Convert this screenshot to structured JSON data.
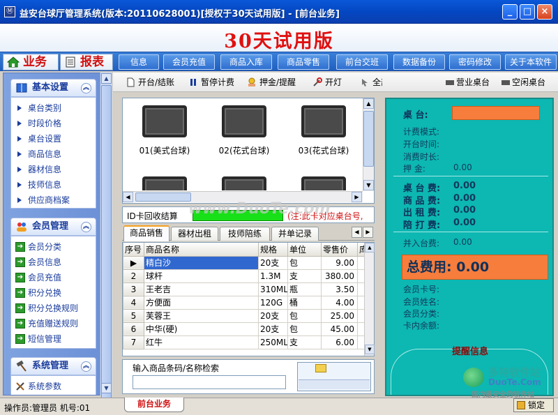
{
  "window": {
    "title": "益安台球厅管理系统(版本:20110628001)[授权于30天试用版] - [前台业务]",
    "min_symbol": "_",
    "max_symbol": "□",
    "close_symbol": "×"
  },
  "banner": {
    "trial_text": "30天试用版"
  },
  "nav": {
    "tab_business": "业务",
    "tab_report": "报表",
    "buttons": [
      "信息",
      "会员充值",
      "商品入库",
      "商品零售",
      "前台交班",
      "数据备份",
      "密码修改",
      "关于本软件"
    ]
  },
  "left": {
    "groups": [
      {
        "title": "基本设置",
        "items": [
          "桌台类别",
          "时段价格",
          "桌台设置",
          "商品信息",
          "器材信息",
          "技师信息",
          "供应商档案"
        ]
      },
      {
        "title": "会员管理",
        "items": [
          "会员分类",
          "会员信息",
          "会员充值",
          "积分兑换",
          "积分兑换规则",
          "充值赠送规则",
          "短信管理"
        ]
      },
      {
        "title": "系统管理",
        "items": [
          "系统参数"
        ]
      }
    ]
  },
  "toolbar": {
    "buttons": [
      "开台/结账",
      "暂停计费",
      "押金/提醒",
      "开灯"
    ],
    "right_fragments": [
      "全部显示",
      "营业桌台",
      "空闲桌台"
    ]
  },
  "tables": [
    {
      "label": "01(美式台球)"
    },
    {
      "label": "02(花式台球)"
    },
    {
      "label": "03(花式台球)"
    }
  ],
  "idcard": {
    "label": "ID卡回收结算",
    "note": "(注:此卡对应桌台号,"
  },
  "watermark_center": "www.DuoTe.com",
  "product_tabs": [
    "商品销售",
    "器材出租",
    "技师陪练",
    "并单记录"
  ],
  "grid": {
    "headers": [
      "序号",
      "商品名称",
      "规格",
      "单位",
      "零售价",
      "库存"
    ],
    "rows": [
      {
        "no": "1",
        "name": "精白沙",
        "spec": "20支",
        "unit": "包",
        "price": "9.00"
      },
      {
        "no": "2",
        "name": "球杆",
        "spec": "1.3M",
        "unit": "支",
        "price": "380.00"
      },
      {
        "no": "3",
        "name": "王老吉",
        "spec": "310ML",
        "unit": "瓶",
        "price": "3.50"
      },
      {
        "no": "4",
        "name": "方便面",
        "spec": "120G",
        "unit": "桶",
        "price": "4.00"
      },
      {
        "no": "5",
        "name": "芙蓉王",
        "spec": "20支",
        "unit": "包",
        "price": "25.00"
      },
      {
        "no": "6",
        "name": "中华(硬)",
        "spec": "20支",
        "unit": "包",
        "price": "45.00"
      },
      {
        "no": "7",
        "name": "红牛",
        "spec": "250ML",
        "unit": "支",
        "price": "6.00"
      }
    ]
  },
  "search": {
    "label": "输入商品条码/名称检索"
  },
  "right": {
    "desk_label": "桌      台:",
    "fields": [
      "计费模式:",
      "开台时间:",
      "消费时长:"
    ],
    "deposit_label": "押      金:",
    "deposit_value": "0.00",
    "fees": [
      {
        "label": "桌 台 费:",
        "value": "0.00"
      },
      {
        "label": "商 品 费:",
        "value": "0.00"
      },
      {
        "label": "出 租 费:",
        "value": "0.00"
      },
      {
        "label": "陪 打 费:",
        "value": "0.00"
      }
    ],
    "merge_label": "并入台费:",
    "merge_value": "0.00",
    "total_label": "总费用:",
    "total_value": "0.00",
    "member_fields": [
      "会员卡号:",
      "会员姓名:",
      "会员分类:",
      "卡内余额:"
    ],
    "remind_title": "提醒信息"
  },
  "status": {
    "text": "操作员:管理员 机号:01",
    "tab": "前台业务",
    "lock": "锁定"
  },
  "site_watermark": {
    "line1": "多特软件站",
    "line2": "DuoTe.Com",
    "line3": "国内最安全的软件站"
  },
  "colors": {
    "accent_orange": "#f67d3c",
    "panel_teal": "#0db7b2",
    "title_blue": "#0447c2",
    "trial_red": "#e01010"
  }
}
